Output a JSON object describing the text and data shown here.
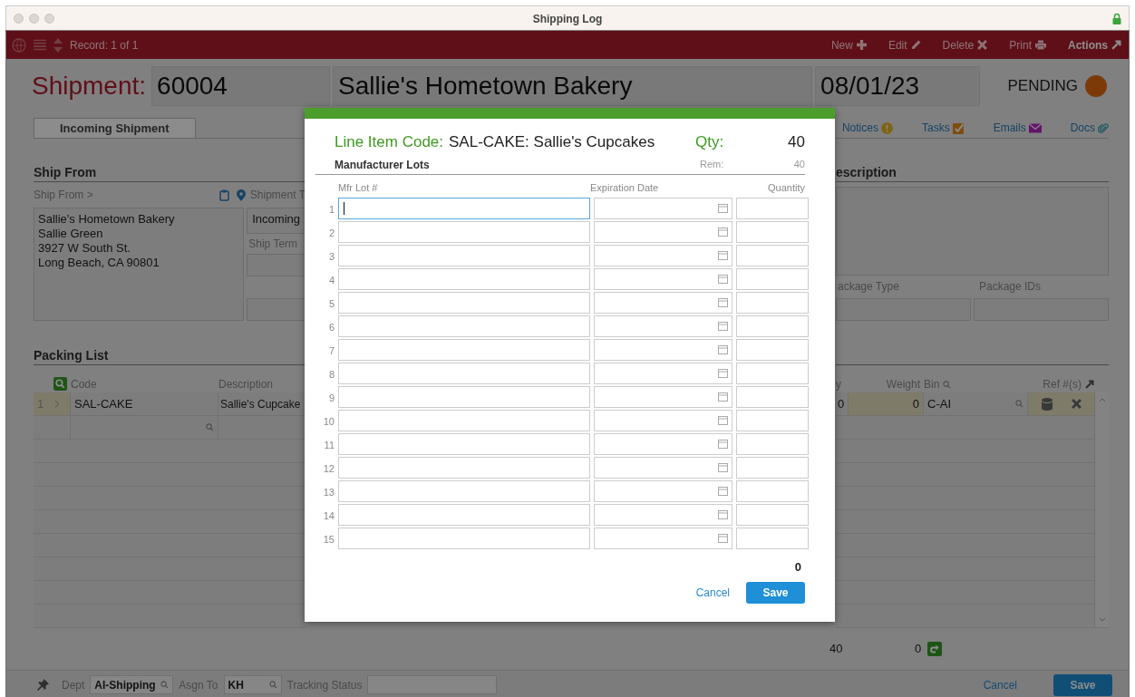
{
  "window": {
    "title": "Shipping Log"
  },
  "toolbar": {
    "record": "Record: 1 of 1",
    "actions": [
      {
        "label": "New",
        "kind": "plus",
        "disabled": true
      },
      {
        "label": "Edit",
        "kind": "pencil",
        "disabled": true
      },
      {
        "label": "Delete",
        "kind": "cross",
        "disabled": true
      },
      {
        "label": "Print",
        "kind": "printer",
        "disabled": true
      },
      {
        "label": "Actions",
        "kind": "arrow",
        "disabled": false
      }
    ]
  },
  "header": {
    "title": "Shipment:",
    "number": "60004",
    "name": "Sallie's Hometown Bakery",
    "date": "08/01/23",
    "status": "PENDING"
  },
  "tabs": [
    {
      "label": "Incoming Shipment",
      "selected": true
    }
  ],
  "links": [
    {
      "label": "Notices",
      "kind": "alert"
    },
    {
      "label": "Tasks",
      "kind": "check"
    },
    {
      "label": "Emails",
      "kind": "mail"
    },
    {
      "label": "Docs",
      "kind": "clip"
    }
  ],
  "ship_from": {
    "heading": "Ship From",
    "label": "Ship From >",
    "address": [
      "Sallie's Hometown Bakery",
      "Sallie Green",
      "3927 W South St.",
      "Long Beach, CA 90801"
    ]
  },
  "shipment_type": {
    "label": "Shipment T",
    "value": "Incoming"
  },
  "ship_terms": {
    "label": "Ship Term"
  },
  "description": {
    "heading": "escription"
  },
  "package": {
    "type_label": "ackage Type",
    "ids_label": "Package IDs"
  },
  "packing_list": {
    "heading": "Packing List",
    "columns_left": [
      "Code",
      "Description"
    ],
    "columns_right": [
      "y",
      "Weight",
      "Bin",
      "Ref #(s)"
    ],
    "rows": [
      {
        "number": "1",
        "code": "SAL-CAKE",
        "description": "Sallie's Cupcake",
        "qty": "0",
        "weight": "0",
        "bin": "C-AI"
      }
    ],
    "totals": {
      "qty": "40",
      "weight": "0"
    }
  },
  "footer": {
    "dept_label": "Dept",
    "dept": "AI-Shipping",
    "assign_label": "Asgn To",
    "assign": "KH",
    "tracking_label": "Tracking Status",
    "cancel": "Cancel",
    "save": "Save"
  },
  "dialog": {
    "code_label": "Line Item Code:",
    "code": "SAL-CAKE: Sallie's Cupcakes",
    "qty_label": "Qty:",
    "qty": "40",
    "section": "Manufacturer Lots",
    "rem_label": "Rem:",
    "rem": "40",
    "columns": [
      "Mfr Lot #",
      "Expiration Date",
      "Quantity"
    ],
    "rows": [
      {
        "number": "1",
        "focused": true
      },
      {
        "number": "2",
        "focused": false
      },
      {
        "number": "3",
        "focused": false
      },
      {
        "number": "4",
        "focused": false
      },
      {
        "number": "5",
        "focused": false
      },
      {
        "number": "6",
        "focused": false
      },
      {
        "number": "7",
        "focused": false
      },
      {
        "number": "8",
        "focused": false
      },
      {
        "number": "9",
        "focused": false
      },
      {
        "number": "10",
        "focused": false
      },
      {
        "number": "11",
        "focused": false
      },
      {
        "number": "12",
        "focused": false
      },
      {
        "number": "13",
        "focused": false
      },
      {
        "number": "14",
        "focused": false
      },
      {
        "number": "15",
        "focused": false
      }
    ],
    "total": "0",
    "cancel": "Cancel",
    "save": "Save"
  }
}
